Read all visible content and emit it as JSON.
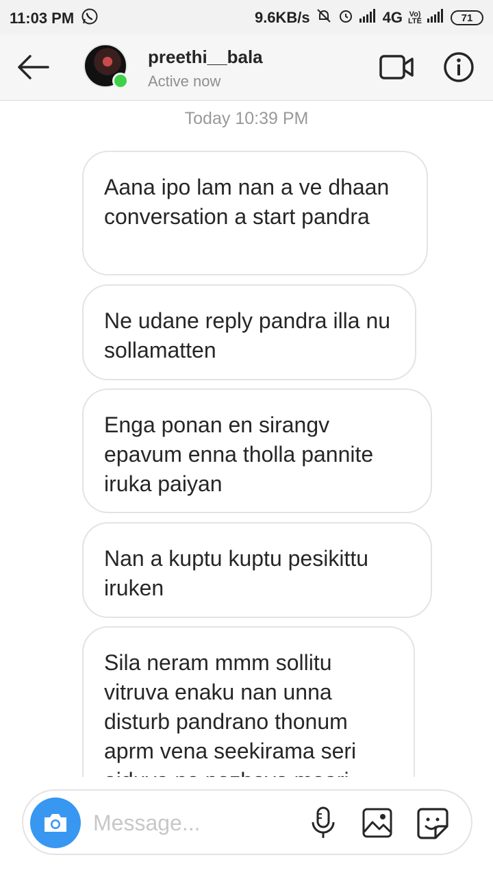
{
  "status_bar": {
    "time": "11:03 PM",
    "net_speed": "9.6KB/s",
    "network_4g": "4G",
    "volte_top": "Vo)",
    "volte_bottom": "LTE",
    "battery": "71",
    "icons": [
      "whatsapp-icon",
      "muted-bell-icon",
      "alarm-icon",
      "signal-icon",
      "signal-icon"
    ]
  },
  "header": {
    "username": "preethi__bala",
    "status": "Active now",
    "online_color": "#3fd14a"
  },
  "chat": {
    "timestamp": "Today 10:39 PM",
    "messages": [
      {
        "text": "Aana ipo lam nan a ve dhaan conversation a start pandra"
      },
      {
        "text": "Ne udane reply pandra illa nu sollamatten"
      },
      {
        "text": "Enga ponan en sirangv epavum enna tholla pannite iruka paiyan"
      },
      {
        "text": "Nan a kuptu kuptu pesikittu iruken"
      },
      {
        "text": "Sila neram mmm sollitu vitruva enaku nan unna disturb pandrano thonum aprm vena seekirama seri aiduva ne pazhaya maari"
      }
    ]
  },
  "composer": {
    "placeholder": "Message...",
    "accent": "#3897f0"
  }
}
